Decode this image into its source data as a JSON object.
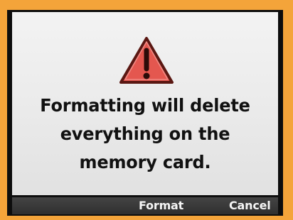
{
  "dialog": {
    "icon": "warning-triangle-icon",
    "message_lines": [
      "Formatting will delete",
      "everything on the",
      "memory card."
    ]
  },
  "softkeys": {
    "format_label": "Format",
    "cancel_label": "Cancel"
  },
  "colors": {
    "outer_frame": "#f4a43a",
    "screen_background": "#0d0d0d",
    "dialog_background": "#eeeeee",
    "warning_fill": "#e4574f",
    "warning_stroke": "#5a1712",
    "softkey_bar": "#3a3a3a",
    "softkey_text": "#f5f5f5",
    "message_text": "#111111"
  }
}
